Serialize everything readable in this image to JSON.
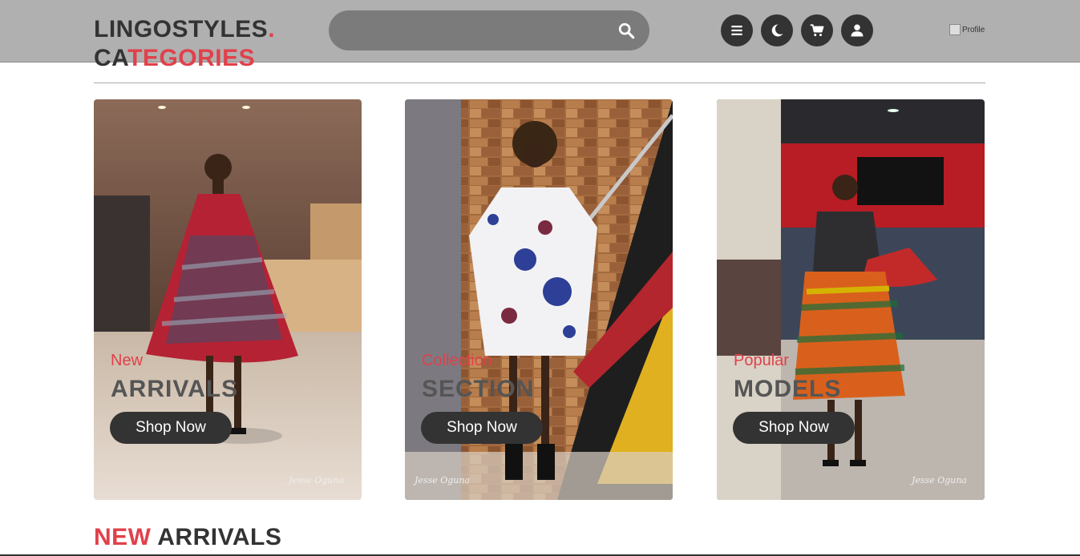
{
  "header": {
    "logo_text": "LINGOSTYLES",
    "logo_dot": ".",
    "search_placeholder": "",
    "profile_alt": "Profile"
  },
  "icons": [
    "menu-icon",
    "moon-icon",
    "cart-icon",
    "user-icon"
  ],
  "categories_heading": {
    "part1": "CA",
    "part2": "TEGORIES"
  },
  "cards": [
    {
      "subtitle": "New",
      "title": "ARRIVALS",
      "button": "Shop Now",
      "signature": "Jesse Oguna"
    },
    {
      "subtitle": "Collection",
      "title": "SECTION",
      "button": "Shop Now",
      "signature": "Jesse Oguna"
    },
    {
      "subtitle": "Popular",
      "title": "MODELS",
      "button": "Shop Now",
      "signature": "Jesse Oguna"
    }
  ],
  "new_arrivals_heading": {
    "part1": "NEW",
    "part2": "ARRIVALS"
  },
  "colors": {
    "accent": "#e0414b",
    "dark": "#333333",
    "header_bg": "#b0b0b0"
  }
}
